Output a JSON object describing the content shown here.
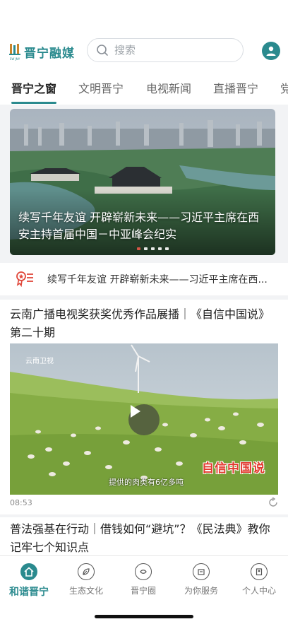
{
  "app": {
    "logo_text": "晋宁融媒",
    "logo_mark_sub": "SW JNY",
    "accent_color": "#2a8a8e"
  },
  "search": {
    "placeholder": "搜索"
  },
  "tabs": [
    {
      "label": "晋宁之窗",
      "active": true
    },
    {
      "label": "文明晋宁",
      "active": false
    },
    {
      "label": "电视新闻",
      "active": false
    },
    {
      "label": "直播晋宁",
      "active": false
    },
    {
      "label": "党",
      "active": false
    }
  ],
  "banner": {
    "title": "续写千年友谊 开辟崭新未来——习近平主席在西安主持首届中国－中亚峰会纪实",
    "dots_count": 5,
    "active_dot": 0
  },
  "notice": {
    "icon": "award-ribbon-icon",
    "text": "续写千年友谊 开辟崭新未来——习近平主席在西..."
  },
  "feed": [
    {
      "title": "云南广播电视奖获奖优秀作品展播｜《自信中国说》第二十期",
      "video": {
        "channel_logo": "云南卫视",
        "program_logo": "自信中国说",
        "subtitle": "提供的肉类有6亿多吨",
        "duration": "08:53"
      }
    },
    {
      "title": "普法强基在行动｜借钱如何“避坑”？《民法典》教你记牢七个知识点"
    }
  ],
  "bottom_nav": [
    {
      "label": "和谐晋宁",
      "icon": "home-icon",
      "active": true
    },
    {
      "label": "生态文化",
      "icon": "leaf-icon",
      "active": false
    },
    {
      "label": "晋宁圈",
      "icon": "circle-icon",
      "active": false
    },
    {
      "label": "为你服务",
      "icon": "service-icon",
      "active": false
    },
    {
      "label": "个人中心",
      "icon": "user-icon",
      "active": false
    }
  ]
}
